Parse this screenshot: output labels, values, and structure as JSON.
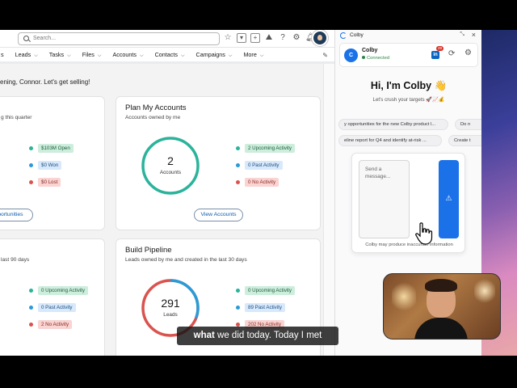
{
  "salesforce": {
    "search_placeholder": "Search...",
    "nav": [
      {
        "label": "s"
      },
      {
        "label": "Leads"
      },
      {
        "label": "Tasks"
      },
      {
        "label": "Files"
      },
      {
        "label": "Accounts"
      },
      {
        "label": "Contacts"
      },
      {
        "label": "Campaigns"
      },
      {
        "label": "More"
      }
    ],
    "greeting": "ening, Connor. Let's get selling!",
    "card_left_top": {
      "sub": "g this quarter",
      "badges": [
        "$103M Open",
        "$0 Won",
        "$0 Lost"
      ],
      "button": "pportunities"
    },
    "plan_accounts": {
      "title": "Plan My Accounts",
      "sub": "Accounts owned by me",
      "count": "2",
      "count_label": "Accounts",
      "badges": [
        "2 Upcoming Activity",
        "0 Past Activity",
        "0 No Activity"
      ],
      "button": "View Accounts"
    },
    "card_left_bottom": {
      "sub": "last 90 days",
      "badges": [
        "0 Upcoming Activity",
        "0 Past Activity",
        "2 No Activity"
      ]
    },
    "build_pipeline": {
      "title": "Build Pipeline",
      "sub": "Leads owned by me and created in the last 30 days",
      "count": "291",
      "count_label": "Leads",
      "badges": [
        "0 Upcoming Activity",
        "89 Past Activity",
        "202 No Activity"
      ],
      "ring_fraction_blue": 0.31
    }
  },
  "colby": {
    "window_title": "Colby",
    "name": "Colby",
    "status": "Connected",
    "avatar_letter": "C",
    "linkedin_label": "in",
    "linkedin_badge": "28",
    "hello": "Hi, I'm Colby 👋",
    "tagline": "Let's crush your targets 🚀📈💰",
    "chips_row1": [
      "y opportunities for the new Colby product l...",
      "Do n"
    ],
    "chips_row2": [
      "eline report for Q4 and identify at-risk ...",
      "Create t"
    ],
    "message_placeholder": "Send a message...",
    "disclaimer": "Colby may produce inaccurate information"
  },
  "caption": {
    "highlight": "what",
    "rest": " we did today. Today I met"
  },
  "colors": {
    "accent": "#1b72e8",
    "green": "#2e844a",
    "teal_ring": "#2bb39b",
    "red_ring": "#d9534f",
    "blue_ring": "#2a9bd8"
  }
}
